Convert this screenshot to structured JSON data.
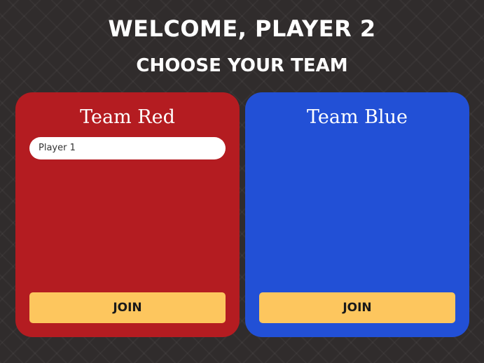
{
  "header": {
    "welcome": "Welcome, Player 2",
    "subtitle": "Choose your team"
  },
  "teams": [
    {
      "name": "Team Red",
      "color": "#b41c21",
      "players": [
        "Player 1"
      ],
      "join_label": "Join"
    },
    {
      "name": "Team Blue",
      "color": "#2250d6",
      "players": [],
      "join_label": "Join"
    }
  ],
  "colors": {
    "background": "#302c2c",
    "button": "#fdc65e"
  }
}
